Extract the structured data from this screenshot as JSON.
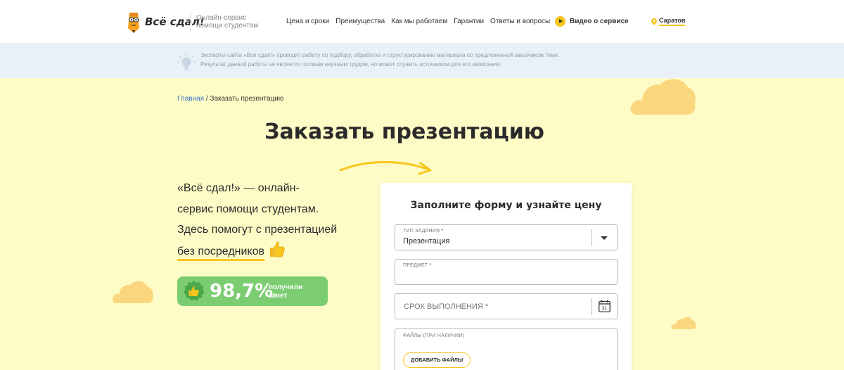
{
  "header": {
    "brand": "Всё сдал!",
    "tagline_line1": "Онлайн-сервис",
    "tagline_line2": "помощи студентам",
    "nav": [
      "Цена и сроки",
      "Преимущества",
      "Как мы работаем",
      "Гарантии",
      "Ответы и вопросы"
    ],
    "video_label": "Видео о сервисе",
    "city": "Саратов"
  },
  "notice": {
    "line1": "Эксперты сайта «Всё сдал!» проводят работу по подбору, обработке и структурированию материала по предложенной заказчиком теме.",
    "line2": "Результат данной работы не является готовым научным трудом, но может служить источником для его написания."
  },
  "breadcrumb": {
    "home": "Главная",
    "separator": "/",
    "current": "Заказать презентацию"
  },
  "page_title": "Заказать презентацию",
  "intro": {
    "line1": "«Всё сдал!» — онлайн-",
    "line2": "сервис помощи студентам.",
    "line3": "Здесь помогут с презентацией",
    "line4": "без посредников"
  },
  "badge": {
    "percent": "98,7%",
    "label_line1": "получили",
    "label_line2": "зачет"
  },
  "form": {
    "title": "Заполните форму и узнайте цену",
    "type_label": "ТИП ЗАДАНИЯ",
    "type_value": "Презентация",
    "subject_label": "ПРЕДМЕТ",
    "deadline_placeholder": "СРОК ВЫПОЛНЕНИЯ",
    "calendar_day": "31",
    "files_label": "ФАЙЛЫ (ПРИ НАЛИЧИИ)",
    "add_files_label": "ДОБАВИТЬ ФАЙЛЫ",
    "required_mark": "*"
  },
  "colors": {
    "accent": "#f7c51d",
    "page_bg": "#fefcc6",
    "notice_bg": "#eaf0f7",
    "badge_green": "#7ccd72",
    "link_blue": "#3b6fc9",
    "cloud": "#fad77e"
  }
}
